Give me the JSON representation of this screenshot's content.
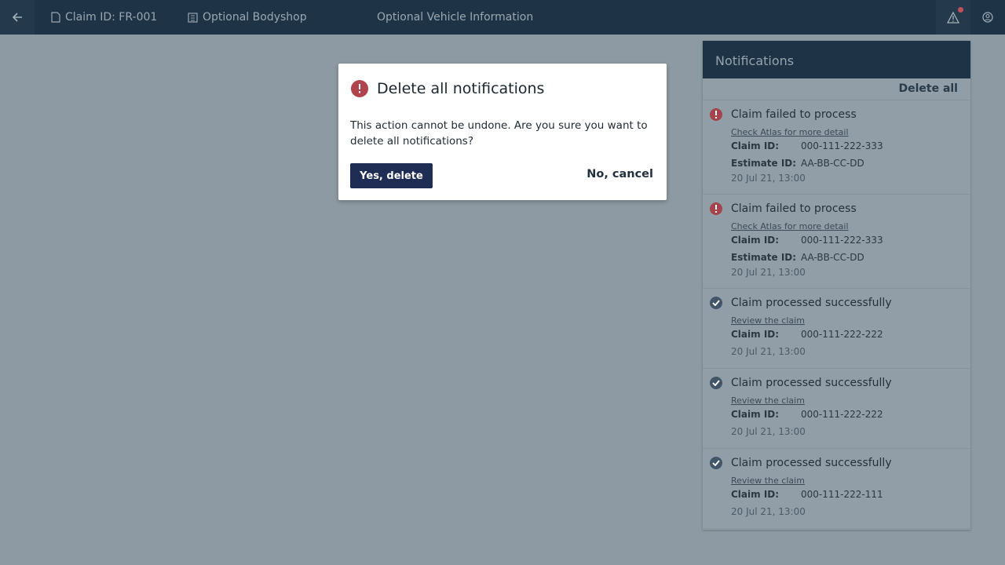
{
  "topbar": {
    "back_icon": "arrow-left-icon",
    "claim_label": "Claim ID: FR-001",
    "bodyshop_label": "Optional Bodyshop",
    "vehicle_label": "Optional Vehicle Information",
    "alert_icon": "warning-triangle-icon",
    "user_icon": "user-circle-icon"
  },
  "colors": {
    "topbar": "#1e3446",
    "overlay": "#8d9aa3",
    "error": "#a4444d",
    "primary_button": "#1f2d55"
  },
  "dialog": {
    "title": "Delete all notifications",
    "body": "This action cannot be undone. Are you sure you want to delete all notifications?",
    "confirm_label": "Yes, delete",
    "cancel_label": "No, cancel"
  },
  "notifications": {
    "title": "Notifications",
    "delete_all_label": "Delete all",
    "items": [
      {
        "status": "error",
        "title": "Claim failed to process",
        "link": "Check Atlas for more detail",
        "claim_key": "Claim ID:",
        "claim_value": "000-111-222-333",
        "estimate_key": "Estimate ID:",
        "estimate_value": "AA-BB-CC-DD",
        "time": "20 Jul 21, 13:00"
      },
      {
        "status": "error",
        "title": "Claim failed to process",
        "link": "Check Atlas for more detail",
        "claim_key": "Claim ID:",
        "claim_value": "000-111-222-333",
        "estimate_key": "Estimate ID:",
        "estimate_value": "AA-BB-CC-DD",
        "time": "20 Jul 21, 13:00"
      },
      {
        "status": "success",
        "title": "Claim processed successfully",
        "link": "Review the claim",
        "claim_key": "Claim ID:",
        "claim_value": "000-111-222-222",
        "time": "20 Jul 21, 13:00"
      },
      {
        "status": "success",
        "title": "Claim processed successfully",
        "link": "Review the claim",
        "claim_key": "Claim ID:",
        "claim_value": "000-111-222-222",
        "time": "20 Jul 21, 13:00"
      },
      {
        "status": "success",
        "title": "Claim processed successfully",
        "link": "Review the claim",
        "claim_key": "Claim ID:",
        "claim_value": "000-111-222-111",
        "time": "20 Jul 21, 13:00"
      }
    ]
  }
}
